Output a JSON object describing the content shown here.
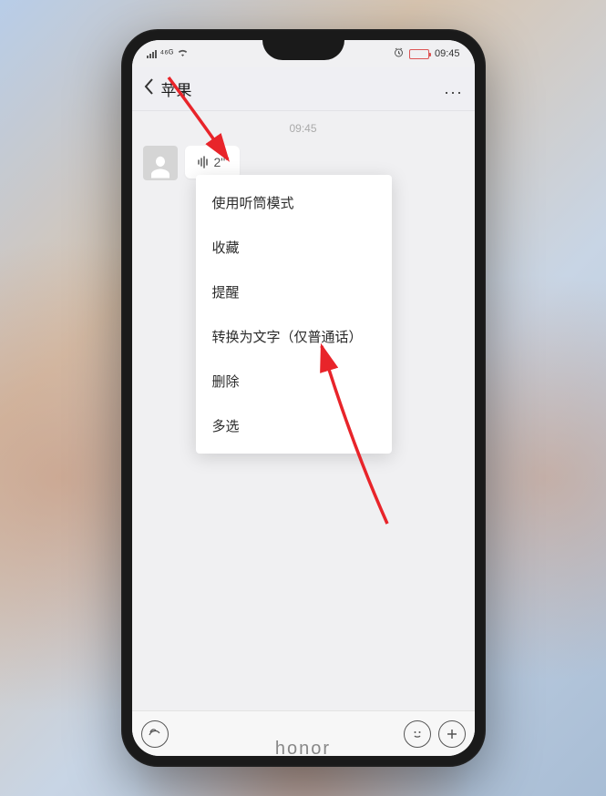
{
  "status_bar": {
    "signal_label": "⁴⁶ᴳ",
    "battery_time": "09:45"
  },
  "header": {
    "title": "苹果",
    "more": "..."
  },
  "chat": {
    "timestamp": "09:45",
    "voice_duration": "2\""
  },
  "context_menu": {
    "items": [
      "使用听筒模式",
      "收藏",
      "提醒",
      "转换为文字（仅普通话）",
      "删除",
      "多选"
    ]
  },
  "brand": "honor"
}
